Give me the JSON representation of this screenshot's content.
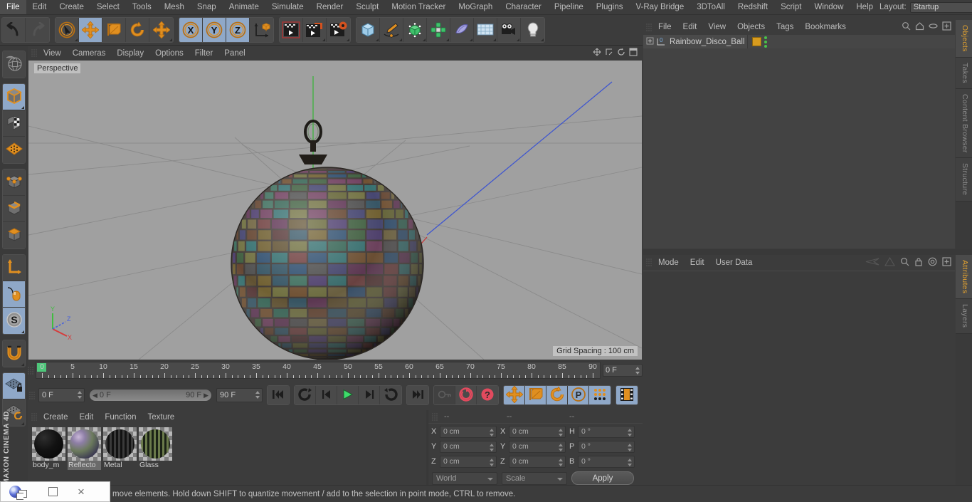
{
  "app": {
    "name": "MAXON CINEMA 4D",
    "sidebar_logo": "MAXON CINEMA 4D"
  },
  "menubar": {
    "items": [
      "File",
      "Edit",
      "Create",
      "Select",
      "Tools",
      "Mesh",
      "Snap",
      "Animate",
      "Simulate",
      "Render",
      "Sculpt",
      "Motion Tracker",
      "MoGraph",
      "Character",
      "Pipeline",
      "Plugins",
      "V-Ray Bridge",
      "3DToAll",
      "Redshift",
      "Script",
      "Window",
      "Help"
    ],
    "layout_label": "Layout:",
    "layout_value": "Startup",
    "search_icon": "search-icon"
  },
  "toolbar": {
    "groups": [
      {
        "name": "undo-redo",
        "buttons": [
          {
            "name": "undo-button",
            "icon": "undo-arrow-icon",
            "active": false,
            "dim": false,
            "corner": false
          },
          {
            "name": "redo-button",
            "icon": "redo-arrow-icon",
            "active": false,
            "dim": true,
            "corner": false
          }
        ]
      },
      {
        "name": "transform-tools",
        "buttons": [
          {
            "name": "select-tool",
            "icon": "live-selection-cursor-icon",
            "active": false,
            "dim": false,
            "corner": true
          },
          {
            "name": "move-tool",
            "icon": "move-arrows-icon",
            "active": true,
            "dim": false,
            "corner": false
          },
          {
            "name": "scale-tool",
            "icon": "scale-box-icon",
            "active": false,
            "dim": false,
            "corner": false
          },
          {
            "name": "rotate-tool",
            "icon": "rotate-circle-icon",
            "active": false,
            "dim": false,
            "corner": false
          },
          {
            "name": "dynamic-place-tool",
            "icon": "move-arrows-icon",
            "active": false,
            "dim": false,
            "corner": true
          }
        ]
      },
      {
        "name": "axis-locks",
        "buttons": [
          {
            "name": "lock-x-axis",
            "icon": "x-axis-icon",
            "active": true,
            "dim": false,
            "corner": false
          },
          {
            "name": "lock-y-axis",
            "icon": "y-axis-icon",
            "active": true,
            "dim": false,
            "corner": false
          },
          {
            "name": "lock-z-axis",
            "icon": "z-axis-icon",
            "active": true,
            "dim": false,
            "corner": false
          },
          {
            "name": "world-object-coordinates",
            "icon": "world-axis-cube-icon",
            "active": false,
            "dim": false,
            "corner": false
          }
        ]
      },
      {
        "name": "render-tools",
        "buttons": [
          {
            "name": "render-view-button",
            "icon": "render-view-clapper-icon",
            "active": false,
            "dim": false,
            "corner": false
          },
          {
            "name": "render-to-picture-viewer-button",
            "icon": "render-picture-viewer-icon",
            "active": false,
            "dim": false,
            "corner": true
          },
          {
            "name": "render-settings-button",
            "icon": "render-settings-gear-icon",
            "active": false,
            "dim": false,
            "corner": true
          }
        ]
      },
      {
        "name": "create-objects",
        "buttons": [
          {
            "name": "add-primitive-cube",
            "icon": "cube-primitive-icon",
            "active": false,
            "dim": false,
            "corner": true
          },
          {
            "name": "add-spline-pen",
            "icon": "spline-pen-icon",
            "active": false,
            "dim": false,
            "corner": true
          },
          {
            "name": "add-generator",
            "icon": "generator-cube-icon",
            "active": false,
            "dim": false,
            "corner": true
          },
          {
            "name": "add-deformer",
            "icon": "deformer-icon",
            "active": false,
            "dim": false,
            "corner": true
          },
          {
            "name": "add-environment",
            "icon": "environment-sky-icon",
            "active": false,
            "dim": false,
            "corner": true
          },
          {
            "name": "add-floor",
            "icon": "floor-grid-icon",
            "active": false,
            "dim": false,
            "corner": true
          },
          {
            "name": "add-camera",
            "icon": "camera-icon",
            "active": false,
            "dim": false,
            "corner": true
          },
          {
            "name": "add-light",
            "icon": "light-bulb-icon",
            "active": false,
            "dim": false,
            "corner": true
          }
        ]
      }
    ]
  },
  "left_toolbar": {
    "groups": [
      {
        "name": "undo-view",
        "buttons": [
          {
            "name": "undo-view-button",
            "icon": "globe-wireframe-icon",
            "active": false,
            "corner": false
          }
        ]
      },
      {
        "name": "selection-modes",
        "buttons": [
          {
            "name": "model-mode",
            "icon": "model-cube-icon",
            "active": true,
            "corner": true
          },
          {
            "name": "texture-mode",
            "icon": "texture-checker-cube-icon",
            "active": false,
            "corner": false
          },
          {
            "name": "workplane-mode",
            "icon": "workplane-grid-icon",
            "active": false,
            "corner": false
          }
        ]
      },
      {
        "name": "component-modes",
        "buttons": [
          {
            "name": "points-mode",
            "icon": "points-cube-icon",
            "active": false,
            "corner": false
          },
          {
            "name": "edges-mode",
            "icon": "edges-cube-icon",
            "active": false,
            "corner": false
          },
          {
            "name": "polygons-mode",
            "icon": "polygons-cube-icon",
            "active": false,
            "corner": false
          }
        ]
      },
      {
        "name": "axis-tools",
        "buttons": [
          {
            "name": "enable-axis-modification",
            "icon": "axis-l-icon",
            "active": false,
            "corner": false
          },
          {
            "name": "viewport-solo-mode",
            "icon": "mouse-icon",
            "active": true,
            "corner": false
          },
          {
            "name": "enable-snapping",
            "icon": "s-circle-icon",
            "active": true,
            "corner": true
          }
        ]
      },
      {
        "name": "magnet",
        "buttons": [
          {
            "name": "magnet-tool",
            "icon": "magnet-icon",
            "active": false,
            "corner": true
          }
        ]
      },
      {
        "name": "workplane-tools",
        "buttons": [
          {
            "name": "lock-workplane",
            "icon": "workplane-lock-icon",
            "active": true,
            "corner": false
          },
          {
            "name": "planar-workplane",
            "icon": "workplane-rotate-icon",
            "active": false,
            "corner": true
          }
        ]
      }
    ]
  },
  "viewport": {
    "menu": [
      "View",
      "Cameras",
      "Display",
      "Options",
      "Filter",
      "Panel"
    ],
    "label": "Perspective",
    "grid_spacing": "Grid Spacing : 100 cm",
    "axis_gizmo": {
      "x": "X",
      "y": "Y",
      "z": "Z",
      "x_color": "#d63b3b",
      "y_color": "#3fbd3f",
      "z_color": "#4a63d8"
    },
    "scene_object": "Rainbow_Disco_Ball",
    "background_color": "#a0a0a0",
    "icons": [
      "move-viewport-icon",
      "scale-viewport-icon",
      "rotate-viewport-icon",
      "maximize-viewport-icon"
    ]
  },
  "timeline": {
    "ticks": [
      0,
      5,
      10,
      15,
      20,
      25,
      30,
      35,
      40,
      45,
      50,
      55,
      60,
      65,
      70,
      75,
      80,
      85,
      90
    ],
    "current_frame_marker": 0,
    "frame_field": "0 F"
  },
  "playback": {
    "current_frame": "0 F",
    "range_start": "0 F",
    "range_end": "90 F",
    "end_frame": "90 F",
    "buttons": [
      {
        "name": "go-to-start-button",
        "icon": "skip-start-icon",
        "active": false,
        "dim": false
      },
      {
        "name": "play-backwards-loop-button",
        "icon": "loop-back-icon",
        "active": false,
        "dim": false
      },
      {
        "name": "previous-frame-button",
        "icon": "step-back-icon",
        "active": false,
        "dim": false
      },
      {
        "name": "play-forward-button",
        "icon": "play-icon",
        "active": false,
        "dim": false
      },
      {
        "name": "next-frame-button",
        "icon": "step-forward-icon",
        "active": false,
        "dim": false
      },
      {
        "name": "loop-playback-button",
        "icon": "loop-icon",
        "active": false,
        "dim": false
      },
      {
        "name": "go-to-end-button",
        "icon": "skip-end-icon",
        "active": false,
        "dim": false
      },
      {
        "name": "record-active-objects-button",
        "icon": "key-icon",
        "active": false,
        "dim": true
      },
      {
        "name": "autokeying-button",
        "icon": "record-circle-icon",
        "active": false,
        "dim": false
      },
      {
        "name": "keyframe-selection-button",
        "icon": "question-circle-icon",
        "active": false,
        "dim": false
      },
      {
        "name": "record-position-button",
        "icon": "move-arrows-icon",
        "active": true,
        "dim": false
      },
      {
        "name": "record-scale-button",
        "icon": "scale-box-icon",
        "active": true,
        "dim": false
      },
      {
        "name": "record-rotation-button",
        "icon": "rotate-circle-icon",
        "active": true,
        "dim": false
      },
      {
        "name": "record-parameter-button",
        "icon": "p-circle-icon",
        "active": true,
        "dim": false
      },
      {
        "name": "record-pla-button",
        "icon": "point-level-animation-icon",
        "active": true,
        "dim": false
      },
      {
        "name": "timeline-toggle-button",
        "icon": "timeline-film-icon",
        "active": true,
        "dim": false
      }
    ]
  },
  "material_manager": {
    "menu": [
      "Create",
      "Edit",
      "Function",
      "Texture"
    ],
    "materials": [
      {
        "name": "body_m",
        "selected": false,
        "color": "#0d0d0d",
        "preview": "black-matte"
      },
      {
        "name": "Reflecto",
        "selected": true,
        "color": "#7a6f8a",
        "preview": "iridescent"
      },
      {
        "name": "Metal",
        "selected": false,
        "color": "#2b2b2b",
        "preview": "striped-metal"
      },
      {
        "name": "Glass",
        "selected": false,
        "color": "#5f6b4a",
        "preview": "striped-glass"
      }
    ]
  },
  "coordinates": {
    "headers": [
      "--",
      "--",
      "--"
    ],
    "rows": [
      {
        "pos_label": "X",
        "pos_value": "0 cm",
        "size_label": "X",
        "size_value": "0 cm",
        "rot_label": "H",
        "rot_value": "0 °"
      },
      {
        "pos_label": "Y",
        "pos_value": "0 cm",
        "size_label": "Y",
        "size_value": "0 cm",
        "rot_label": "P",
        "rot_value": "0 °"
      },
      {
        "pos_label": "Z",
        "pos_value": "0 cm",
        "size_label": "Z",
        "size_value": "0 cm",
        "rot_label": "B",
        "rot_value": "0 °"
      }
    ],
    "system_dropdown": "World",
    "mode_dropdown": "Scale",
    "apply_label": "Apply"
  },
  "object_manager": {
    "menu": [
      "File",
      "Edit",
      "View",
      "Objects",
      "Tags",
      "Bookmarks"
    ],
    "icons": [
      "search-icon",
      "home-icon",
      "ellipse-icon",
      "plus-box-icon"
    ],
    "objects": [
      {
        "name": "Rainbow_Disco_Ball",
        "layer_badge": "0",
        "tag_color": "#d79b1e",
        "visible": true
      }
    ]
  },
  "attribute_manager": {
    "menu": [
      "Mode",
      "Edit",
      "User Data"
    ],
    "icons": [
      "history-back-icon",
      "history-forward-icon",
      "search-icon",
      "lock-icon",
      "target-icon",
      "plus-box-icon"
    ]
  },
  "right_tabs_top": [
    {
      "label": "Objects",
      "active": true
    },
    {
      "label": "Takes",
      "active": false
    },
    {
      "label": "Content Browser",
      "active": false
    },
    {
      "label": "Structure",
      "active": false
    }
  ],
  "right_tabs_bottom": [
    {
      "label": "Attributes",
      "active": true
    },
    {
      "label": "Layers",
      "active": false
    }
  ],
  "status_bar": {
    "message": "move elements. Hold down SHIFT to quantize movement / add to the selection in point mode, CTRL to remove."
  },
  "float_window": {
    "icon": "app-orb-icon",
    "restore_label": "restore-icon",
    "maximize_label": "maximize-icon",
    "close_label": "×"
  },
  "colors": {
    "accent_orange": "#e0a030",
    "active_blue": "#8fa8c8",
    "panel_bg": "#3c3c3c",
    "viewport_bg": "#a0a0a0"
  }
}
